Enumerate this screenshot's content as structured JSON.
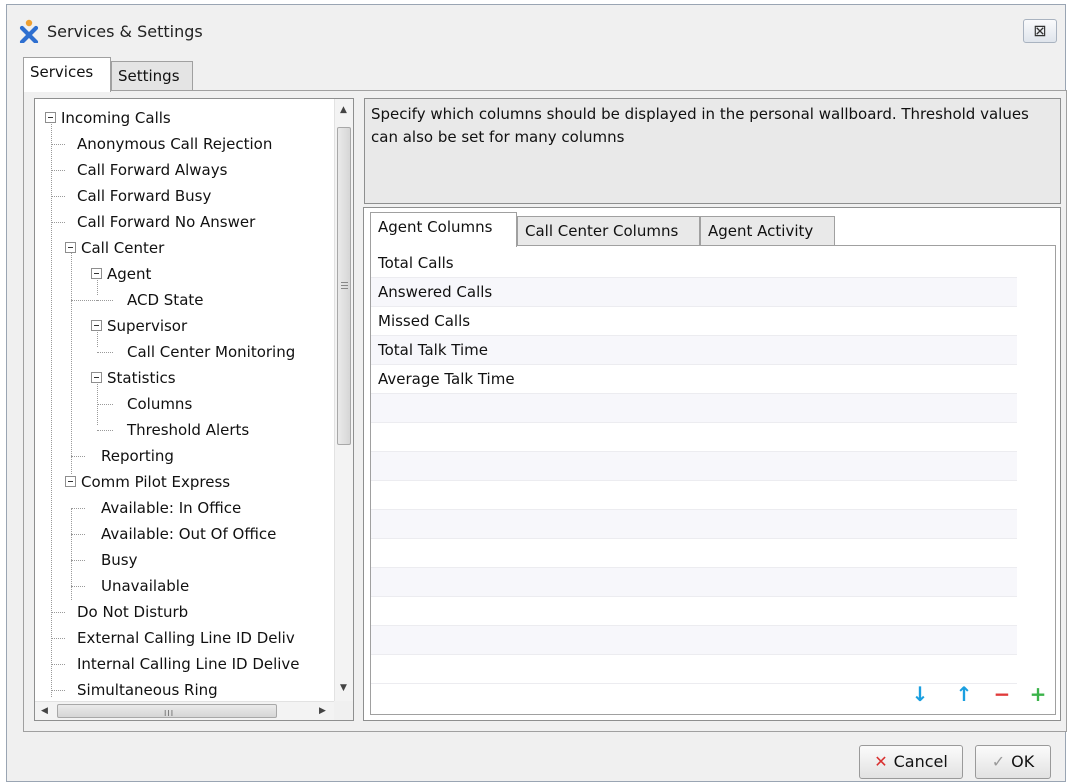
{
  "window": {
    "title": "Services & Settings",
    "close_label": "⊠",
    "colors": {
      "accent_orange": "#f0a030",
      "accent_blue": "#2e6fd0",
      "frame": "#f0f0f0"
    }
  },
  "outer_tabs": [
    {
      "label": "Services",
      "active": true
    },
    {
      "label": "Settings",
      "active": false
    }
  ],
  "tree": {
    "items": [
      {
        "label": "Incoming Calls",
        "expanded": true
      },
      {
        "label": "Anonymous Call Rejection"
      },
      {
        "label": "Call Forward Always"
      },
      {
        "label": "Call Forward Busy"
      },
      {
        "label": "Call Forward No Answer"
      },
      {
        "label": "Call Center",
        "expanded": true
      },
      {
        "label": "Agent",
        "expanded": true
      },
      {
        "label": "ACD State"
      },
      {
        "label": "Supervisor",
        "expanded": true
      },
      {
        "label": "Call Center Monitoring"
      },
      {
        "label": "Statistics",
        "expanded": true
      },
      {
        "label": "Columns",
        "selected": true
      },
      {
        "label": "Threshold Alerts"
      },
      {
        "label": "Reporting"
      },
      {
        "label": "Comm Pilot Express",
        "expanded": true
      },
      {
        "label": "Available: In Office"
      },
      {
        "label": "Available: Out Of Office"
      },
      {
        "label": "Busy"
      },
      {
        "label": "Unavailable"
      },
      {
        "label": "Do Not Disturb"
      },
      {
        "label": "External Calling Line ID Deliv"
      },
      {
        "label": "Internal Calling Line ID Delive"
      },
      {
        "label": "Simultaneous Ring"
      }
    ],
    "scrollbar": {
      "h_grip": "III"
    }
  },
  "description": "Specify which columns should be displayed in the personal wallboard.  Threshold values can also be set for many columns",
  "inner_tabs": [
    {
      "label": "Agent Columns",
      "active": true
    },
    {
      "label": "Call Center Columns",
      "active": false
    },
    {
      "label": "Agent Activity",
      "active": false
    }
  ],
  "agent_columns": [
    "Total Calls",
    "Answered Calls",
    "Missed Calls",
    "Total Talk Time",
    "Average Talk Time"
  ],
  "list_actions": {
    "move_down": {
      "glyph": "↓",
      "color": "#1a9fe0"
    },
    "move_up": {
      "glyph": "↑",
      "color": "#1a9fe0"
    },
    "remove": {
      "glyph": "−",
      "color": "#e03a3a"
    },
    "add": {
      "glyph": "+",
      "color": "#3bb34a"
    }
  },
  "buttons": {
    "cancel": {
      "label": "Cancel",
      "icon_glyph": "✕",
      "icon_color": "#d9302f"
    },
    "ok": {
      "label": "OK",
      "icon_glyph": "✓",
      "icon_color": "#9a9a9a"
    }
  }
}
